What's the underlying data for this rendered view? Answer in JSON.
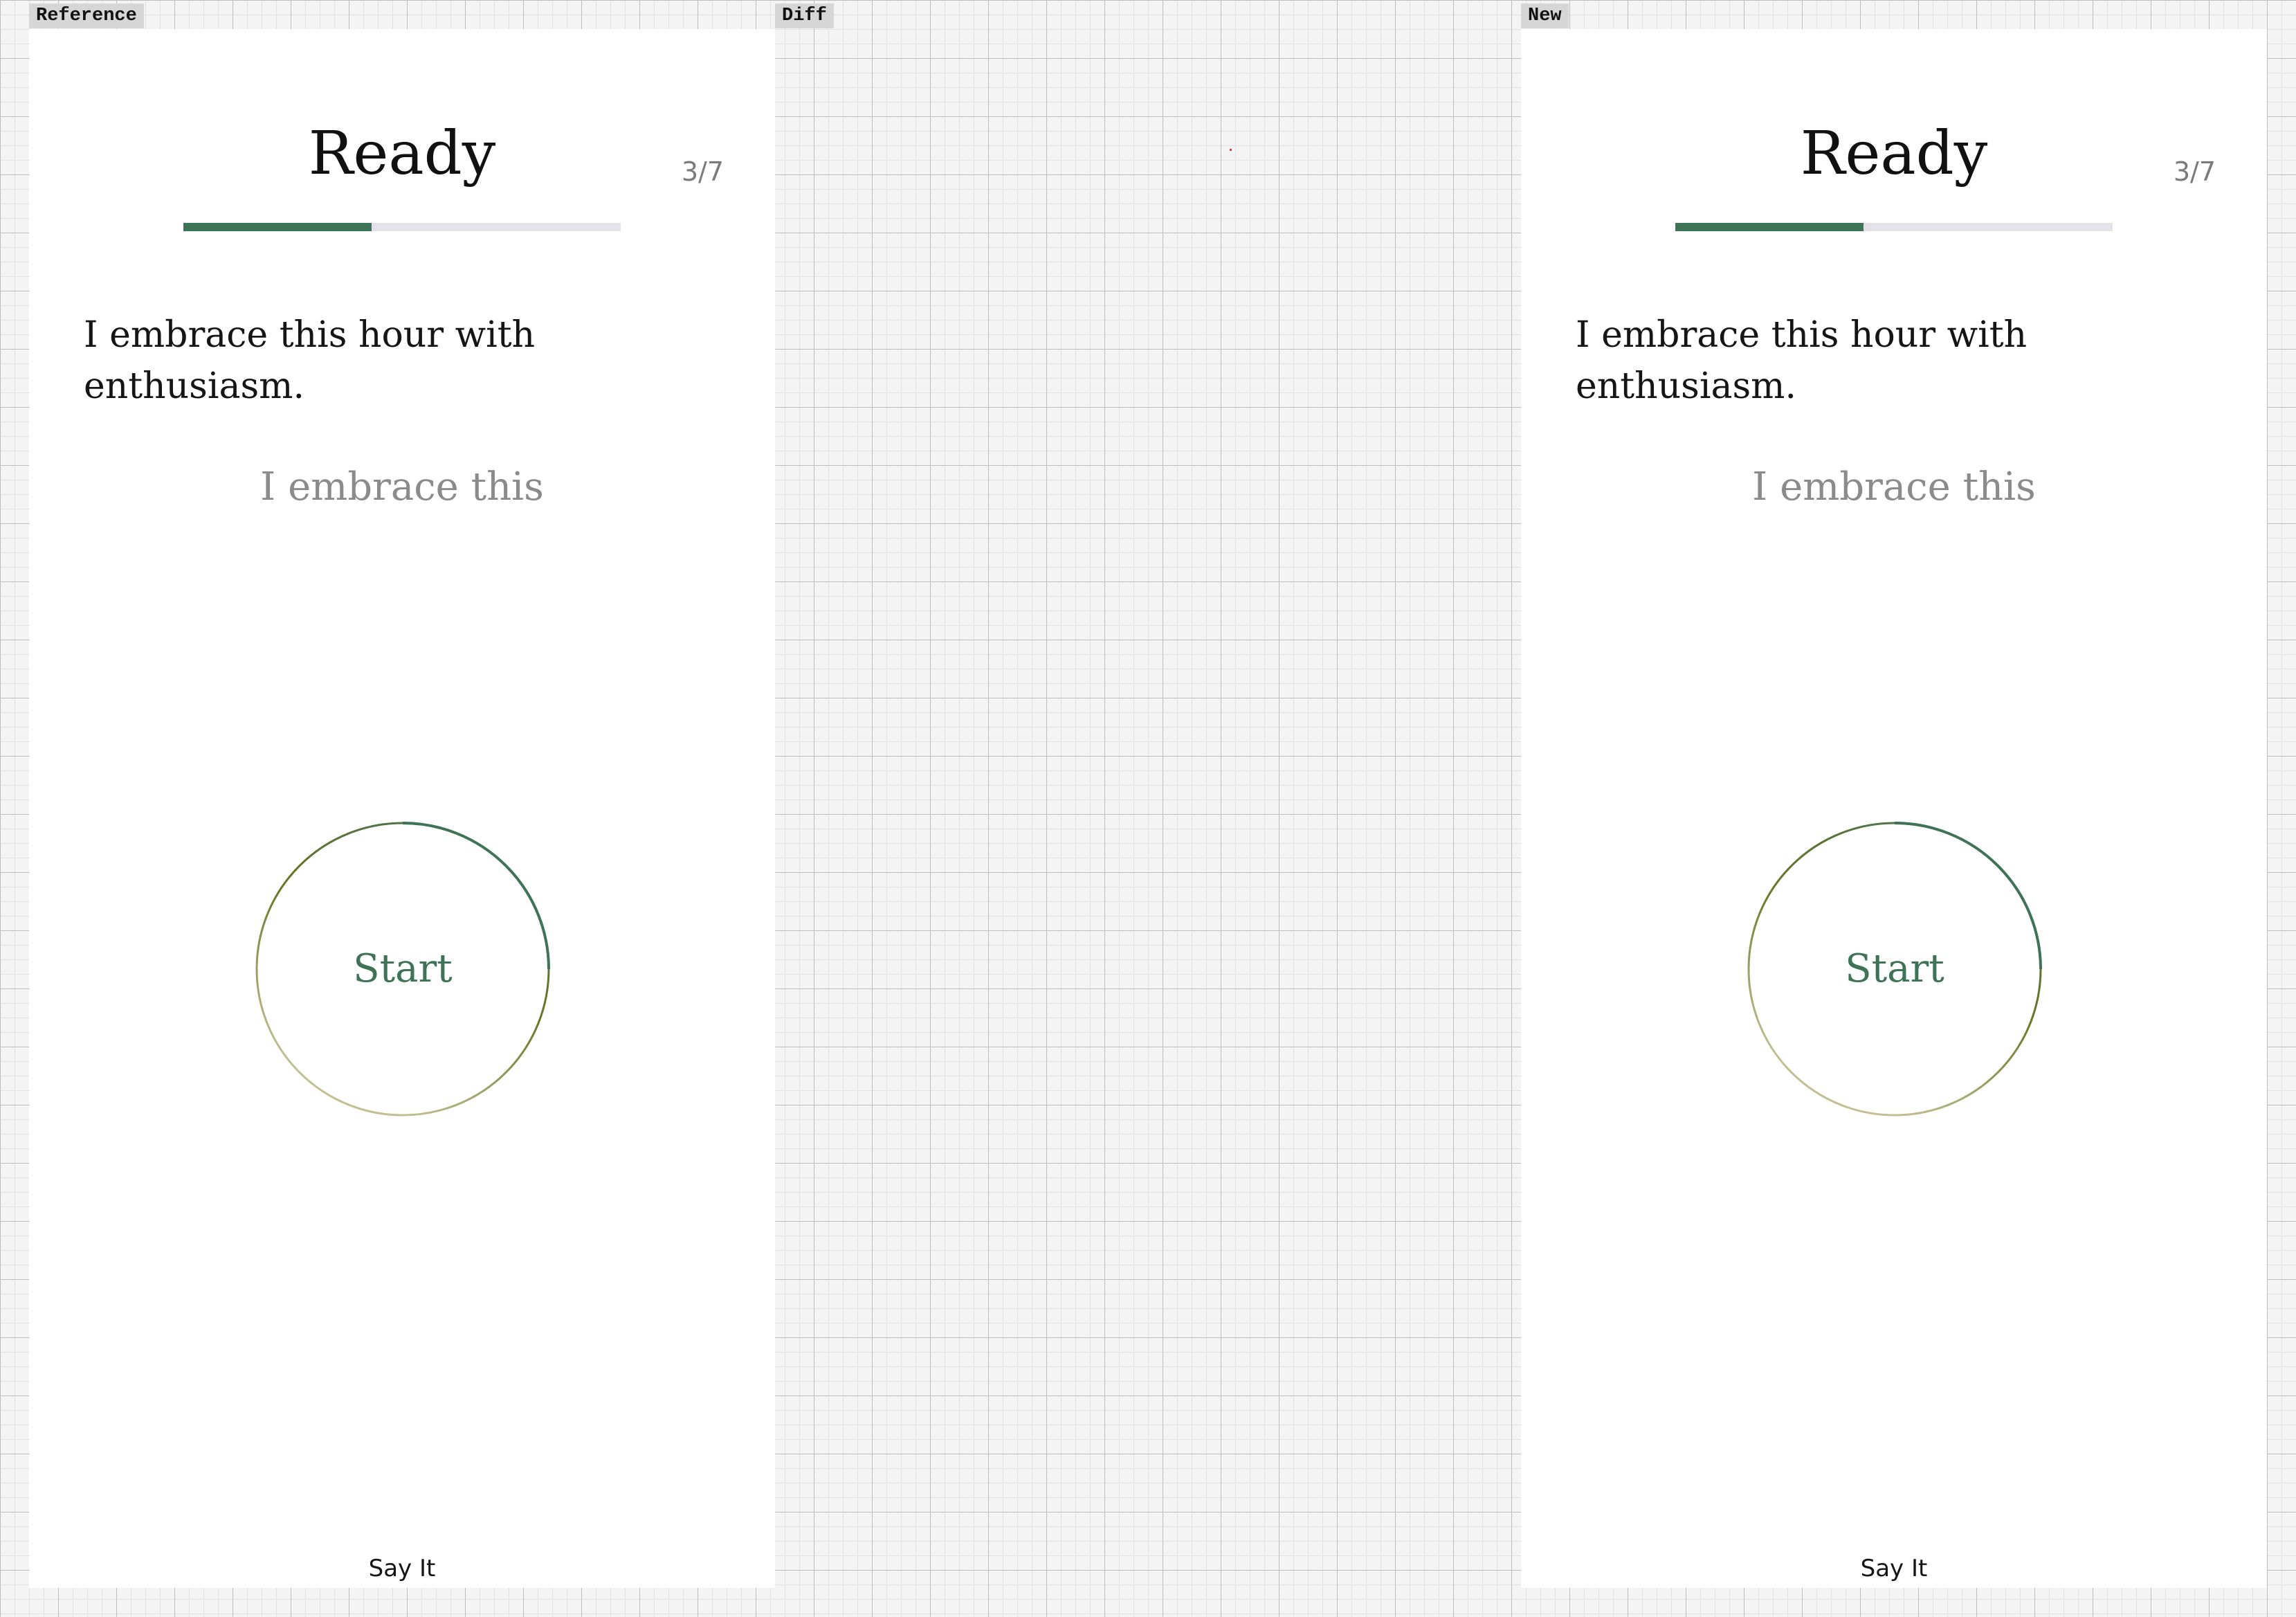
{
  "labels": {
    "reference": "Reference",
    "diff": "Diff",
    "new": "New"
  },
  "screen": {
    "title": "Ready",
    "step": "3/7",
    "progress": 0.43,
    "affirmation": "I embrace this hour with enthusiasm.",
    "spoken_text": "I embrace this",
    "start_button": "Start",
    "footer": "Say It"
  },
  "colors": {
    "accent": "#3f7357",
    "ring_start": "#3f7357",
    "ring_mid": "#6b7526",
    "ring_end": "#c0c092",
    "track": "#e4e2e8"
  }
}
